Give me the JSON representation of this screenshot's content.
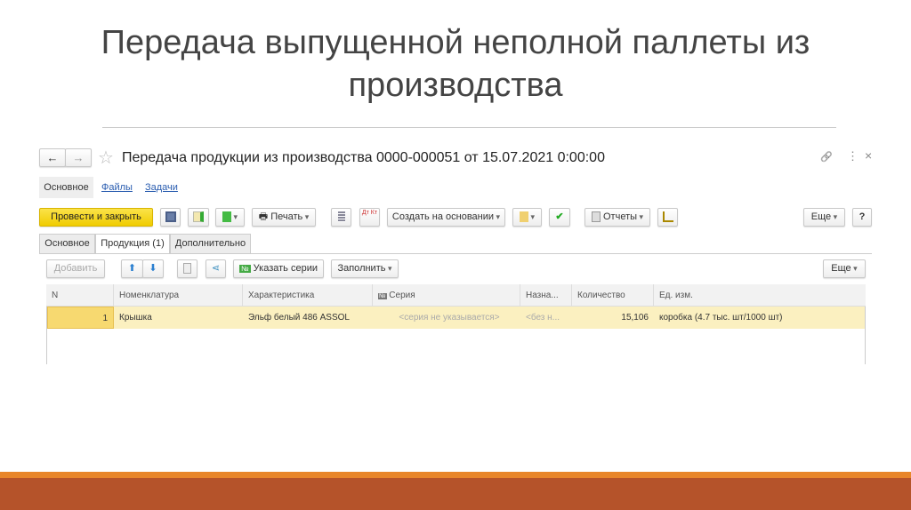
{
  "slide": {
    "title": "Передача выпущенной неполной паллеты из производства"
  },
  "window": {
    "title": "Передача продукции из производства 0000-000051 от 15.07.2021 0:00:00"
  },
  "nav": {
    "back": "←",
    "forward": "→",
    "star": "☆",
    "link": "🔗",
    "more": "⋮",
    "close": "×"
  },
  "sections": [
    "Основное",
    "Файлы",
    "Задачи"
  ],
  "toolbar": {
    "post_close": "Провести и закрыть",
    "print": "Печать",
    "create_based": "Создать на основании",
    "reports": "Отчеты",
    "more": "Еще",
    "help": "?",
    "dtkt": "Дт Кт"
  },
  "tabs": [
    "Основное",
    "Продукция (1)",
    "Дополнительно"
  ],
  "subtoolbar": {
    "add": "Добавить",
    "set_series": "Указать серии",
    "fill": "Заполнить",
    "more": "Еще",
    "n_badge": "№"
  },
  "table": {
    "columns": [
      "N",
      "Номенклатура",
      "Характеристика",
      "Серия",
      "Назна...",
      "Количество",
      "Ед. изм."
    ],
    "rows": [
      [
        "1",
        "Крышка",
        "Эльф белый 486 ASSOL",
        "<серия не указывается>",
        "<без н...",
        "15,106",
        "коробка (4.7 тыс. шт/1000 шт)"
      ]
    ]
  },
  "colors": {
    "accent": "#f5d300",
    "row": "#fbf0c0",
    "bar": "#b5532a",
    "stripe": "#e8862a"
  }
}
